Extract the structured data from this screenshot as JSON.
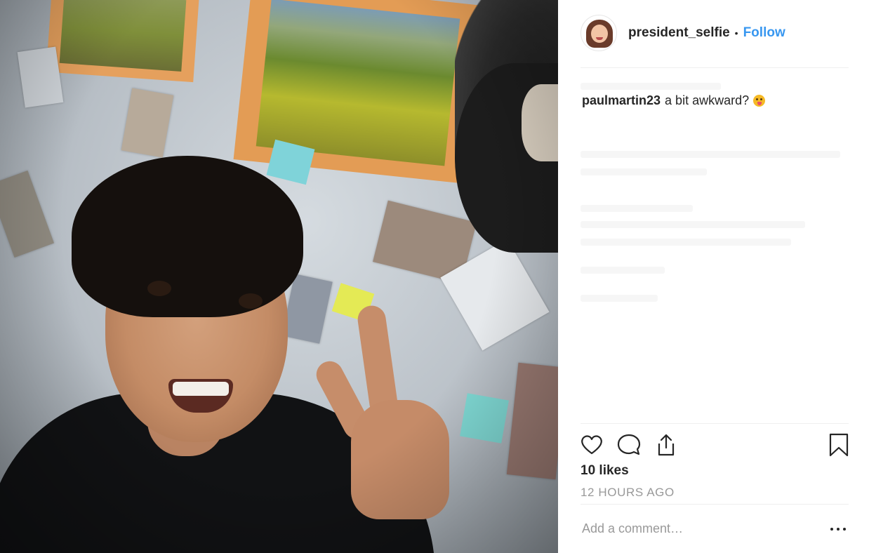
{
  "post": {
    "username": "president_selfie",
    "separator": "•",
    "follow_label": "Follow"
  },
  "comments": [
    {
      "user": "paulmartin23",
      "text": "a bit awkward?"
    }
  ],
  "stats": {
    "likes": "10 likes",
    "time": "12 HOURS AGO"
  },
  "comment_box": {
    "placeholder": "Add a comment…"
  },
  "icons": {
    "like": "heart-icon",
    "comment": "comment-icon",
    "share": "share-icon",
    "save": "bookmark-icon",
    "more": "more-options-icon"
  },
  "colors": {
    "follow": "#3897f0",
    "text": "#262626",
    "muted": "#999999",
    "divider": "#efefef"
  }
}
